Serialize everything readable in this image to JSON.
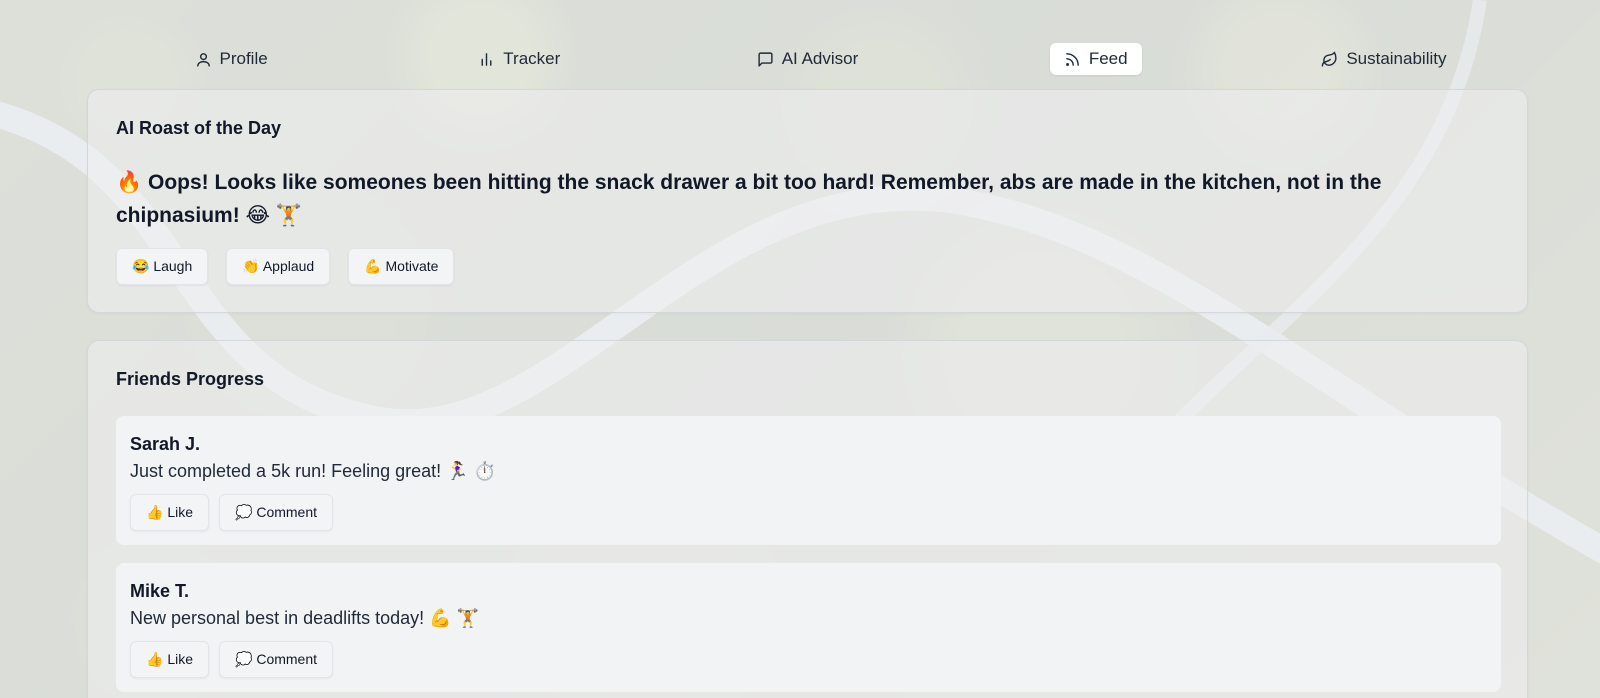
{
  "nav": {
    "items": [
      {
        "label": "Profile",
        "icon": "user-icon",
        "active": false
      },
      {
        "label": "Tracker",
        "icon": "bar-chart-icon",
        "active": false
      },
      {
        "label": "AI Advisor",
        "icon": "message-square-icon",
        "active": false
      },
      {
        "label": "Feed",
        "icon": "rss-icon",
        "active": true
      },
      {
        "label": "Sustainability",
        "icon": "leaf-icon",
        "active": false
      }
    ]
  },
  "roast": {
    "title": "AI Roast of the Day",
    "text": "🔥 Oops! Looks like someones been hitting the snack drawer a bit too hard! Remember, abs are made in the kitchen, not in the chipnasium! 😂 🏋️",
    "reactions": [
      {
        "label": "😂 Laugh"
      },
      {
        "label": "👏 Applaud"
      },
      {
        "label": "💪 Motivate"
      }
    ]
  },
  "friends": {
    "title": "Friends Progress",
    "posts": [
      {
        "name": "Sarah J.",
        "text": "Just completed a 5k run! Feeling great! 🏃‍♀️ ⏱️",
        "like_label": "👍 Like",
        "comment_label": "💭 Comment"
      },
      {
        "name": "Mike T.",
        "text": "New personal best in deadlifts today! 💪 🏋️",
        "like_label": "👍 Like",
        "comment_label": "💭 Comment"
      }
    ]
  }
}
